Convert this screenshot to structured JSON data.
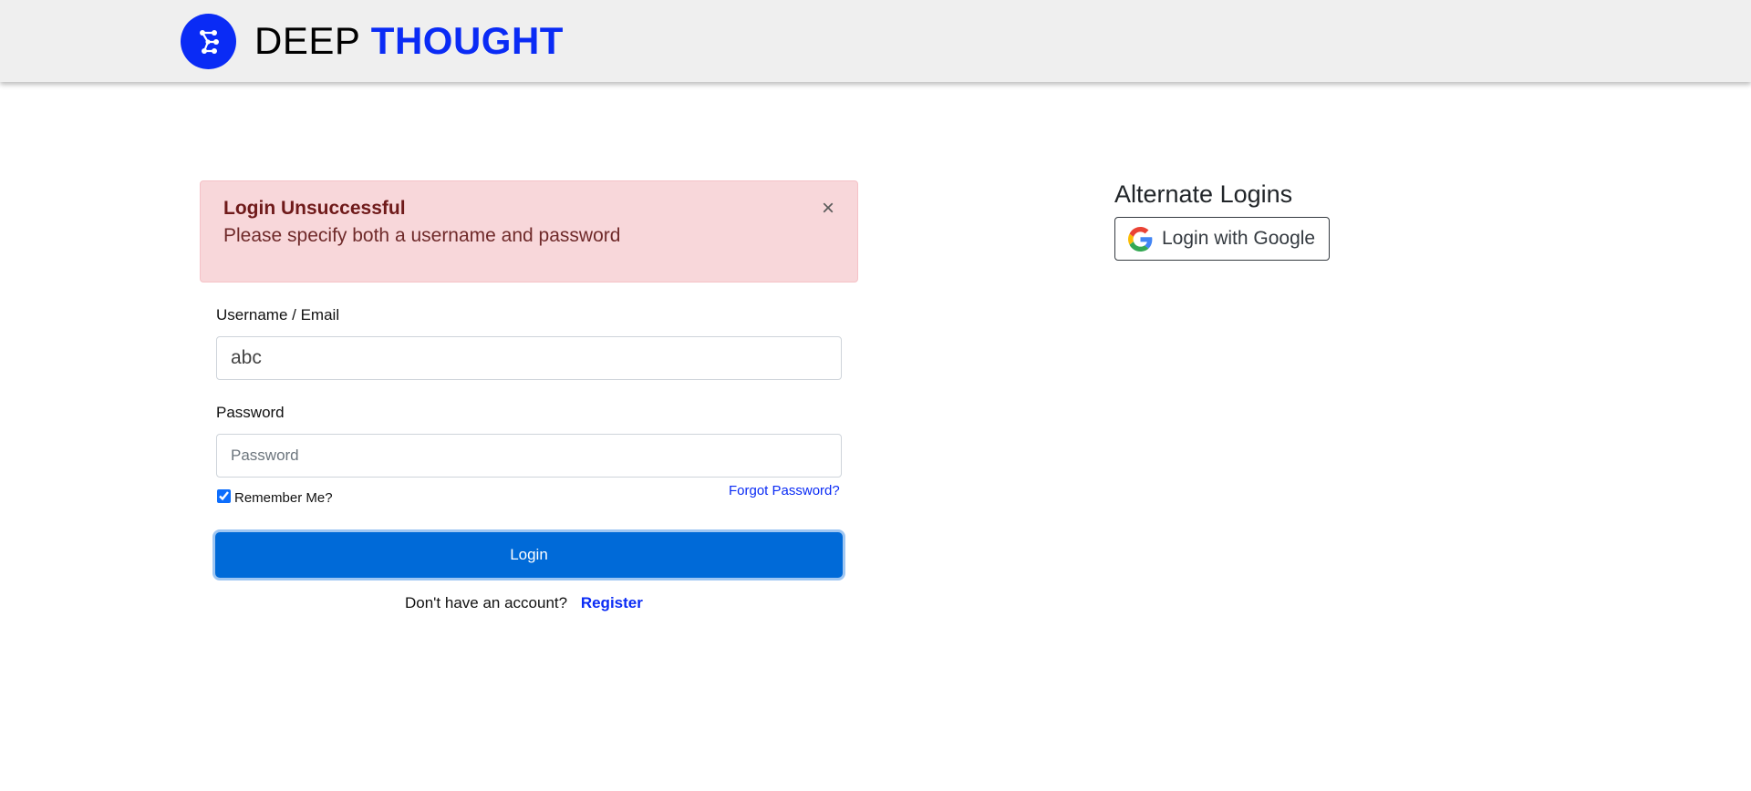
{
  "header": {
    "brand_part1": "DEEP",
    "brand_part2": "THOUGHT",
    "logo_icon": "network-graph-icon",
    "brand_color": "#0a2bf5"
  },
  "alert": {
    "title": "Login Unsuccessful",
    "message": "Please specify both a username and password",
    "close_glyph": "×",
    "background": "#f8d7da"
  },
  "form": {
    "username_label": "Username / Email",
    "username_value": "abc",
    "password_label": "Password",
    "password_placeholder": "Password",
    "remember_label": "Remember Me?",
    "remember_checked": true,
    "forgot_link": "Forgot Password?",
    "login_button": "Login",
    "no_account_text": "Don't have an account?",
    "register_link": "Register",
    "button_color": "#006ad8"
  },
  "alternate": {
    "title": "Alternate Logins",
    "google_button": "Login with Google",
    "google_icon": "google-icon"
  }
}
